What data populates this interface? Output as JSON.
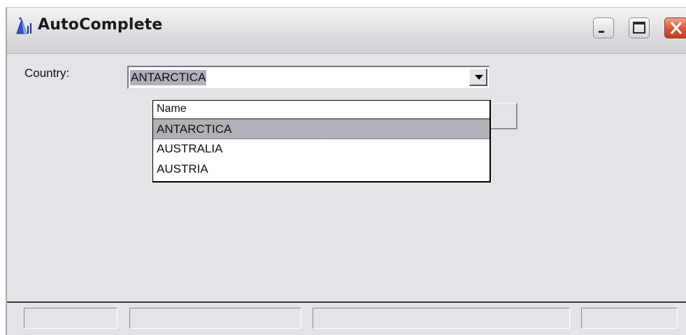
{
  "window": {
    "title": "AutoComplete",
    "icon": "app-pyramid-icon"
  },
  "form": {
    "country_label": "Country:",
    "country_value": "ANTARCTICA"
  },
  "dropdown": {
    "header": "Name",
    "items": [
      {
        "label": "ANTARCTICA",
        "selected": true
      },
      {
        "label": "AUSTRALIA",
        "selected": false
      },
      {
        "label": "AUSTRIA",
        "selected": false
      }
    ]
  },
  "colors": {
    "window_bg": "#e4e3e8",
    "selection_bg": "#aeb0bb",
    "close_button": "#d9553a"
  }
}
